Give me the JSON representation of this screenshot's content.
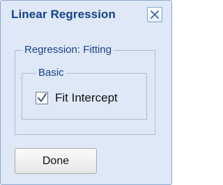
{
  "dialog": {
    "title": "Linear Regression",
    "close_icon": "close-icon"
  },
  "fitting_group": {
    "legend": "Regression: Fitting"
  },
  "basic_group": {
    "legend": "Basic",
    "fit_intercept": {
      "label": "Fit Intercept",
      "checked": true
    }
  },
  "footer": {
    "done_label": "Done"
  },
  "colors": {
    "dialog_background": "#dfe8f6",
    "title_text": "#15428b",
    "border": "#8aa8d0"
  }
}
